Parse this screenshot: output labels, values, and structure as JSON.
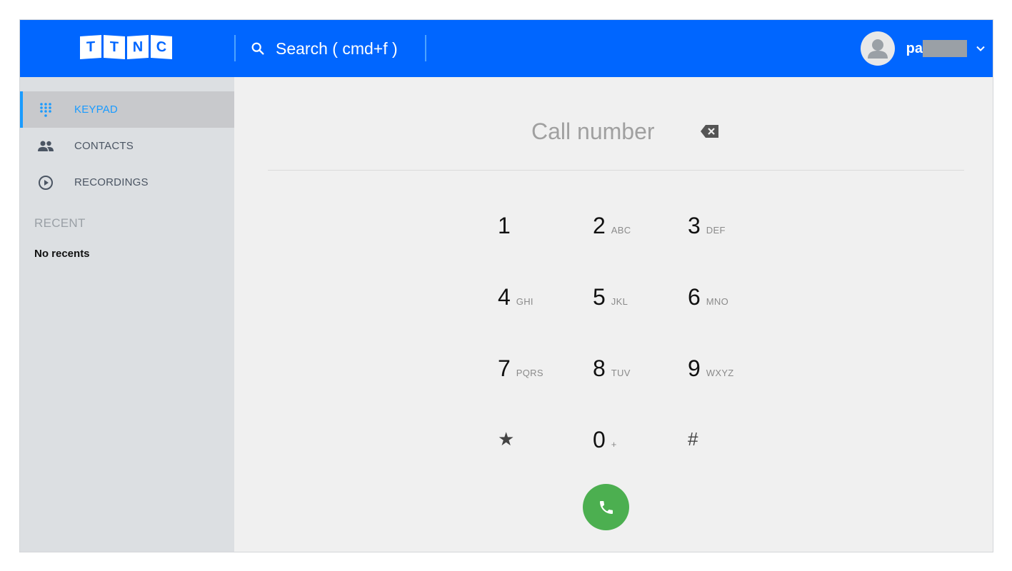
{
  "header": {
    "logo_letters": [
      "T",
      "T",
      "N",
      "C"
    ],
    "search_label": "Search ( cmd+f )",
    "username": "pa"
  },
  "sidebar": {
    "items": [
      {
        "label": "KEYPAD",
        "icon": "dialpad-icon",
        "active": true
      },
      {
        "label": "CONTACTS",
        "icon": "people-icon",
        "active": false
      },
      {
        "label": "RECORDINGS",
        "icon": "play-circle-icon",
        "active": false
      }
    ],
    "recent_heading": "RECENT",
    "recent_empty": "No recents"
  },
  "dialer": {
    "placeholder": "Call number",
    "keys": [
      {
        "digit": "1",
        "letters": ""
      },
      {
        "digit": "2",
        "letters": "ABC"
      },
      {
        "digit": "3",
        "letters": "DEF"
      },
      {
        "digit": "4",
        "letters": "GHI"
      },
      {
        "digit": "5",
        "letters": "JKL"
      },
      {
        "digit": "6",
        "letters": "MNO"
      },
      {
        "digit": "7",
        "letters": "PQRS"
      },
      {
        "digit": "8",
        "letters": "TUV"
      },
      {
        "digit": "9",
        "letters": "WXYZ"
      },
      {
        "digit": "★",
        "letters": ""
      },
      {
        "digit": "0",
        "letters": "+"
      },
      {
        "digit": "#",
        "letters": ""
      }
    ]
  },
  "colors": {
    "brand": "#0066ff",
    "accent": "#1a9bff",
    "call": "#4caf50"
  }
}
